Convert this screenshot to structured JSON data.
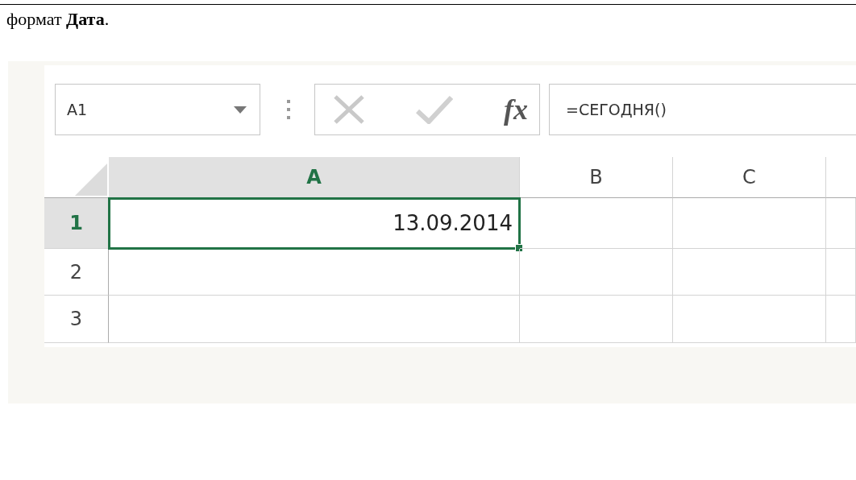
{
  "intro": "формат **Дата**.",
  "name_box": {
    "value": "A1"
  },
  "formula_bar": {
    "fx": "fx",
    "value": "=СЕГОДНЯ()"
  },
  "columns": [
    {
      "label": "A",
      "selected": true
    },
    {
      "label": "B",
      "selected": false
    },
    {
      "label": "C",
      "selected": false
    }
  ],
  "rows": [
    {
      "label": "1",
      "selected": true,
      "cell_a": "13.09.2014"
    },
    {
      "label": "2",
      "selected": false
    },
    {
      "label": "3",
      "selected": false
    }
  ]
}
